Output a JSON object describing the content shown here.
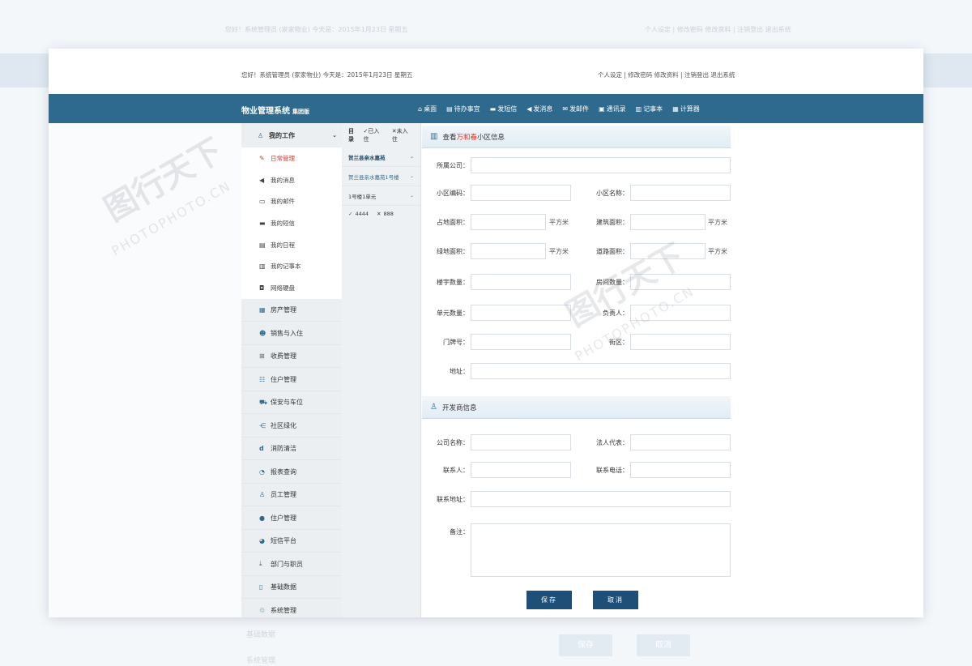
{
  "topbar": {
    "greeting": "您好！系统管理员 (家家物业)    今天是：2015年1月23日 星期五",
    "links": "个人设定 | 修改密码  修改资料 | 注销登出  退出系统"
  },
  "navbar": {
    "brand": "物业管理系统",
    "edition": "集团版",
    "menu": [
      {
        "icon": "home-icon",
        "label": "桌面"
      },
      {
        "icon": "calendar-icon",
        "label": "待办事宜"
      },
      {
        "icon": "sms-icon",
        "label": "发短信"
      },
      {
        "icon": "megaphone-icon",
        "label": "发消息"
      },
      {
        "icon": "mail-icon",
        "label": "发邮件"
      },
      {
        "icon": "contacts-icon",
        "label": "通讯录"
      },
      {
        "icon": "notepad-icon",
        "label": "记事本"
      },
      {
        "icon": "calculator-icon",
        "label": "计算器"
      }
    ]
  },
  "sidebar": {
    "head": "我的工作",
    "sub_items": [
      "日常管理",
      "我的消息",
      "我的邮件",
      "我的短信",
      "我的日程",
      "我的记事本",
      "网络硬盘"
    ],
    "groups": [
      "房产管理",
      "销售与入住",
      "收费管理",
      "住户管理",
      "保安与车位",
      "社区绿化",
      "消防清洁",
      "报表查询",
      "员工管理",
      "住户管理",
      "短信平台",
      "部门与职员",
      "基础数据",
      "系统管理"
    ]
  },
  "tree": {
    "title": "目录",
    "checked_in": "已入住",
    "not_in": "未入住",
    "node1": "贺兰县亲水嘉苑",
    "node2": "贺兰县亲水嘉苑1号楼",
    "node3": "1号楼1单元",
    "leaf_ok": "4444",
    "leaf_no": "888"
  },
  "community_section": {
    "title_prefix": "查看",
    "title_highlight": "万和春",
    "title_suffix": "小区信息",
    "labels": {
      "company": "所属公司：",
      "code": "小区编码：",
      "name": "小区名称：",
      "land_area": "占地面积：",
      "build_area": "建筑面积：",
      "green_area": "绿地面积：",
      "road_area": "道路面积：",
      "buildings": "楼宇数量：",
      "rooms": "房间数量：",
      "units": "单元数量：",
      "manager": "负责人：",
      "door_no": "门牌号：",
      "street": "街区：",
      "address": "地址："
    },
    "unit": "平方米"
  },
  "developer_section": {
    "title": "开发商信息",
    "labels": {
      "company_name": "公司名称：",
      "legal_rep": "法人代表：",
      "contact": "联系人：",
      "phone": "联系电话：",
      "contact_address": "联系地址：",
      "remark": "备注："
    }
  },
  "buttons": {
    "save": "保存",
    "cancel": "取消"
  },
  "watermark": {
    "logo": "图行天下",
    "text": "PHOTOPHOTO.CN"
  },
  "colors": {
    "nav": "#2e6a8e",
    "accent": "#d9362b",
    "button": "#1d4f78"
  }
}
